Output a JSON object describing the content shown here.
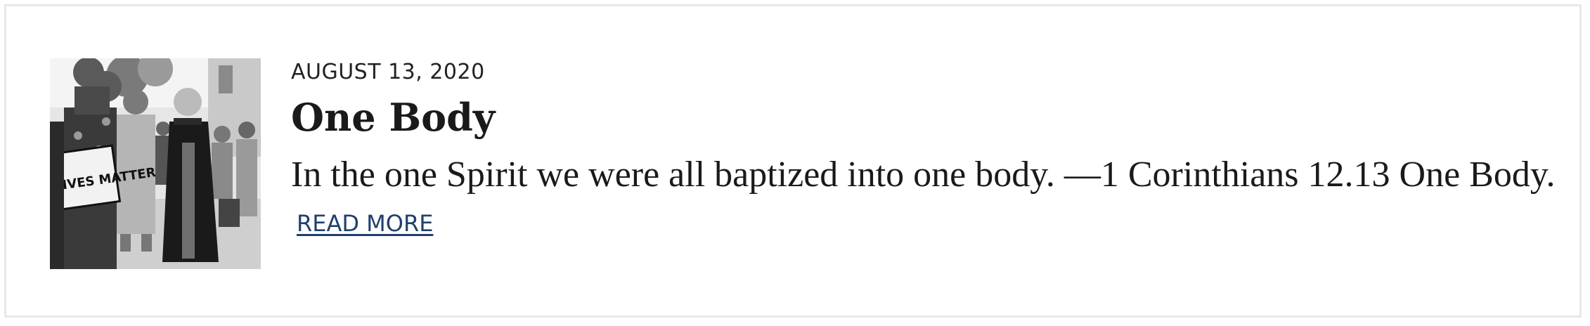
{
  "post": {
    "date": "AUGUST 13, 2020",
    "title": "One Body",
    "excerpt": "In the one Spirit we were all baptized into one body. —1 Corinthians 12.13 One Body.",
    "read_more": "READ MORE",
    "thumbnail_sign_text": "LIVES MATTER"
  },
  "colors": {
    "link": "#1f3f6e",
    "border": "#e8e8e8",
    "text": "#1a1a1a"
  }
}
